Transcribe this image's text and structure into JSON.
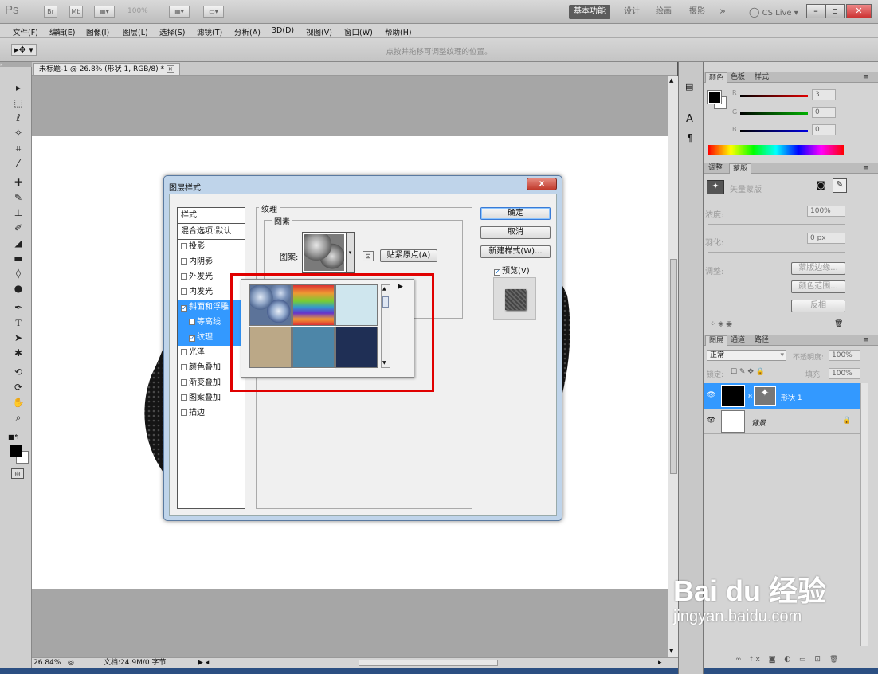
{
  "app": {
    "logo": "Ps",
    "bridge_buttons": [
      "Br",
      "Mb"
    ],
    "zoom_value": "100%",
    "workspaces": [
      "基本功能",
      "设计",
      "绘画",
      "摄影"
    ],
    "more": "»",
    "cs_live": "CS Live",
    "window_buttons": [
      "–",
      "▫",
      "✕"
    ]
  },
  "menu": [
    "文件(F)",
    "编辑(E)",
    "图像(I)",
    "图层(L)",
    "选择(S)",
    "滤镜(T)",
    "分析(A)",
    "3D(D)",
    "视图(V)",
    "窗口(W)",
    "帮助(H)"
  ],
  "options": {
    "hint": "点按并拖移可调整纹理的位置。"
  },
  "document": {
    "tab_title": "未标题-1 @ 26.8% (形状 1, RGB/8) *",
    "status_zoom": "26.84%",
    "status_doc": "文档:24.9M/0 字节"
  },
  "color_panel": {
    "tabs": [
      "颜色",
      "色板",
      "样式"
    ],
    "channels": [
      {
        "label": "R",
        "value": "3",
        "color": "#e00000"
      },
      {
        "label": "G",
        "value": "0",
        "color": "#00b000"
      },
      {
        "label": "B",
        "value": "0",
        "color": "#0000e0"
      }
    ]
  },
  "adjust_panel": {
    "tabs": [
      "调整",
      "蒙版"
    ],
    "mask_title": "矢量蒙版",
    "density_label": "浓度:",
    "density_value": "100%",
    "feather_label": "羽化:",
    "feather_value": "0 px",
    "adjust_label": "调整:",
    "buttons": [
      "蒙版边缘...",
      "颜色范围...",
      "反相"
    ]
  },
  "layers_panel": {
    "tabs": [
      "图层",
      "通道",
      "路径"
    ],
    "blend_mode": "正常",
    "opacity_label": "不透明度:",
    "opacity_value": "100%",
    "lock_label": "锁定:",
    "fill_label": "填充:",
    "fill_value": "100%",
    "layers": [
      {
        "name": "形状 1",
        "selected": true
      },
      {
        "name": "背景",
        "selected": false
      }
    ]
  },
  "dialog": {
    "title": "图层样式",
    "close": "x",
    "style_items": [
      {
        "label": "样式",
        "type": "header"
      },
      {
        "label": "混合选项:默认",
        "type": "header"
      },
      {
        "label": "投影",
        "checked": false
      },
      {
        "label": "内阴影",
        "checked": false
      },
      {
        "label": "外发光",
        "checked": false
      },
      {
        "label": "内发光",
        "checked": false
      },
      {
        "label": "斜面和浮雕",
        "checked": true,
        "highlight": true
      },
      {
        "label": "等高线",
        "checked": false,
        "sub": true,
        "highlight": true
      },
      {
        "label": "纹理",
        "checked": true,
        "sub": true,
        "highlight": true
      },
      {
        "label": "光泽",
        "checked": false
      },
      {
        "label": "颜色叠加",
        "checked": false
      },
      {
        "label": "渐变叠加",
        "checked": false
      },
      {
        "label": "图案叠加",
        "checked": false
      },
      {
        "label": "描边",
        "checked": false
      }
    ],
    "section_title": "纹理",
    "group_title": "图素",
    "pattern_label": "图案:",
    "snap_button": "贴紧原点(A)",
    "buttons": {
      "ok": "确定",
      "cancel": "取消",
      "new_style": "新建样式(W)...",
      "preview": "预览(V)"
    }
  },
  "watermark": {
    "brand": "Bai du 经验",
    "url": "jingyan.baidu.com"
  }
}
